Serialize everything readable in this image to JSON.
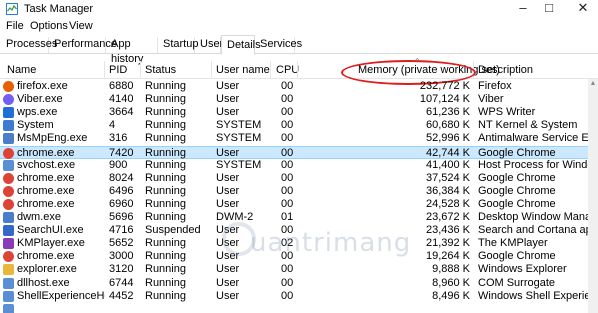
{
  "window": {
    "title": "Task Manager",
    "minimize_glyph": "–",
    "maximize_glyph": "□",
    "close_glyph": "✕"
  },
  "menu": [
    "File",
    "Options",
    "View"
  ],
  "tabs": [
    "Processes",
    "Performance",
    "App history",
    "Startup",
    "Users",
    "Details",
    "Services"
  ],
  "active_tab": "Details",
  "columns": {
    "name": "Name",
    "pid": "PID",
    "status": "Status",
    "user": "User name",
    "cpu": "CPU",
    "memory": "Memory (private working set)",
    "description": "Description"
  },
  "rows": [
    {
      "icon": "firefox-icon",
      "color": "#e66000",
      "name": "firefox.exe",
      "pid": "6880",
      "status": "Running",
      "user": "User",
      "cpu": "00",
      "memory": "232,772 K",
      "description": "Firefox"
    },
    {
      "icon": "viber-icon",
      "color": "#7360f2",
      "name": "Viber.exe",
      "pid": "4140",
      "status": "Running",
      "user": "User",
      "cpu": "00",
      "memory": "107,124 K",
      "description": "Viber"
    },
    {
      "icon": "wps-icon",
      "color": "#1f6fd6",
      "name": "wps.exe",
      "pid": "3664",
      "status": "Running",
      "user": "User",
      "cpu": "00",
      "memory": "61,236 K",
      "description": "WPS Writer"
    },
    {
      "icon": "system-icon",
      "color": "#3b7bd4",
      "name": "System",
      "pid": "4",
      "status": "Running",
      "user": "SYSTEM",
      "cpu": "00",
      "memory": "60,680 K",
      "description": "NT Kernel & System"
    },
    {
      "icon": "msmpeng-icon",
      "color": "#4a7ec9",
      "name": "MsMpEng.exe",
      "pid": "316",
      "status": "Running",
      "user": "SYSTEM",
      "cpu": "00",
      "memory": "52,996 K",
      "description": "Antimalware Service Executab"
    },
    {
      "icon": "chrome-icon",
      "color": "#db4437",
      "name": "chrome.exe",
      "pid": "7420",
      "status": "Running",
      "user": "User",
      "cpu": "00",
      "memory": "42,744 K",
      "description": "Google Chrome",
      "selected": true
    },
    {
      "icon": "svchost-icon",
      "color": "#5a8fd6",
      "name": "svchost.exe",
      "pid": "900",
      "status": "Running",
      "user": "SYSTEM",
      "cpu": "00",
      "memory": "41,400 K",
      "description": "Host Process for Windows Se"
    },
    {
      "icon": "chrome-icon",
      "color": "#db4437",
      "name": "chrome.exe",
      "pid": "8024",
      "status": "Running",
      "user": "User",
      "cpu": "00",
      "memory": "37,524 K",
      "description": "Google Chrome"
    },
    {
      "icon": "chrome-icon",
      "color": "#db4437",
      "name": "chrome.exe",
      "pid": "6496",
      "status": "Running",
      "user": "User",
      "cpu": "00",
      "memory": "36,384 K",
      "description": "Google Chrome"
    },
    {
      "icon": "chrome-icon",
      "color": "#db4437",
      "name": "chrome.exe",
      "pid": "6960",
      "status": "Running",
      "user": "User",
      "cpu": "00",
      "memory": "24,528 K",
      "description": "Google Chrome"
    },
    {
      "icon": "dwm-icon",
      "color": "#4a7ec9",
      "name": "dwm.exe",
      "pid": "5696",
      "status": "Running",
      "user": "DWM-2",
      "cpu": "01",
      "memory": "23,672 K",
      "description": "Desktop Window Manager"
    },
    {
      "icon": "searchui-icon",
      "color": "#3367c8",
      "name": "SearchUI.exe",
      "pid": "4716",
      "status": "Suspended",
      "user": "User",
      "cpu": "00",
      "memory": "23,436 K",
      "description": "Search and Cortana applicati"
    },
    {
      "icon": "kmplayer-icon",
      "color": "#8a3ab9",
      "name": "KMPlayer.exe",
      "pid": "5652",
      "status": "Running",
      "user": "User",
      "cpu": "02",
      "memory": "21,392 K",
      "description": "The KMPlayer"
    },
    {
      "icon": "chrome-icon",
      "color": "#db4437",
      "name": "chrome.exe",
      "pid": "3000",
      "status": "Running",
      "user": "User",
      "cpu": "00",
      "memory": "19,264 K",
      "description": "Google Chrome"
    },
    {
      "icon": "explorer-icon",
      "color": "#e8b83a",
      "name": "explorer.exe",
      "pid": "3120",
      "status": "Running",
      "user": "User",
      "cpu": "00",
      "memory": "9,888 K",
      "description": "Windows Explorer"
    },
    {
      "icon": "dllhost-icon",
      "color": "#5a8fd6",
      "name": "dllhost.exe",
      "pid": "6744",
      "status": "Running",
      "user": "User",
      "cpu": "00",
      "memory": "8,960 K",
      "description": "COM Surrogate"
    },
    {
      "icon": "shellexperience-icon",
      "color": "#5a8fd6",
      "name": "ShellExperienceHost....",
      "pid": "4452",
      "status": "Running",
      "user": "User",
      "cpu": "00",
      "memory": "8,496 K",
      "description": "Windows Shell Experience H"
    },
    {
      "icon": "process-icon",
      "color": "#5a8fd6",
      "name": "",
      "pid": "",
      "status": "",
      "user": "",
      "cpu": "",
      "memory": "",
      "description": ""
    }
  ],
  "watermark": "uantrimang"
}
